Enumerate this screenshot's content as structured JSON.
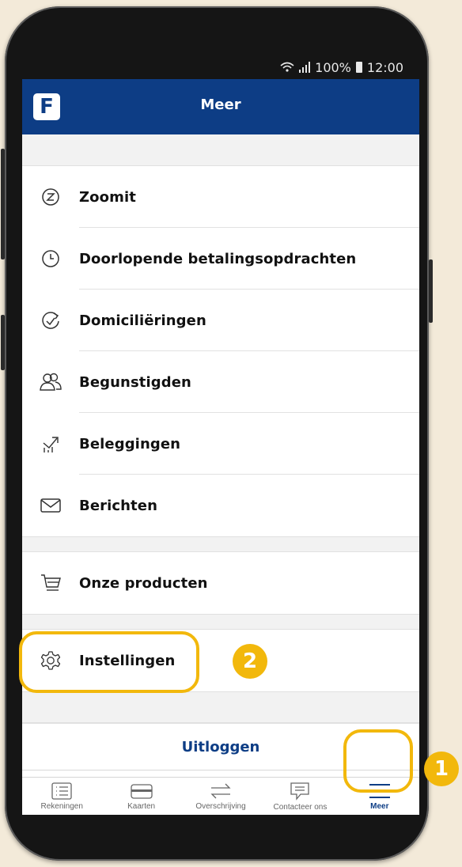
{
  "status_bar": {
    "battery": "100%",
    "time": "12:00"
  },
  "app_bar": {
    "logo_letter": "F",
    "title": "Meer"
  },
  "menu": {
    "group1": [
      {
        "label": "Zoomit",
        "icon": "zoomit-icon"
      },
      {
        "label": "Doorlopende betalingsopdrachten",
        "icon": "clock-icon"
      },
      {
        "label": "Domiciliëringen",
        "icon": "recurring-check-icon"
      },
      {
        "label": "Begunstigden",
        "icon": "beneficiaries-icon"
      },
      {
        "label": "Beleggingen",
        "icon": "investments-chart-icon"
      },
      {
        "label": "Berichten",
        "icon": "envelope-icon"
      }
    ],
    "group2": [
      {
        "label": "Onze producten",
        "icon": "cart-icon"
      }
    ],
    "group3": [
      {
        "label": "Instellingen",
        "icon": "gear-icon"
      }
    ],
    "logout": "Uitloggen"
  },
  "tab_bar": [
    {
      "label": "Rekeningen",
      "icon": "list-icon"
    },
    {
      "label": "Kaarten",
      "icon": "card-icon"
    },
    {
      "label": "Overschrijving",
      "icon": "transfer-arrows-icon"
    },
    {
      "label": "Contacteer ons",
      "icon": "chat-icon"
    },
    {
      "label": "Meer",
      "icon": "hamburger-menu-icon",
      "active": true
    }
  ],
  "annotations": {
    "step1": "1",
    "step2": "2"
  },
  "colors": {
    "brand": "#0d3d85",
    "highlight": "#f2b80c",
    "background": "#f3ead9"
  }
}
